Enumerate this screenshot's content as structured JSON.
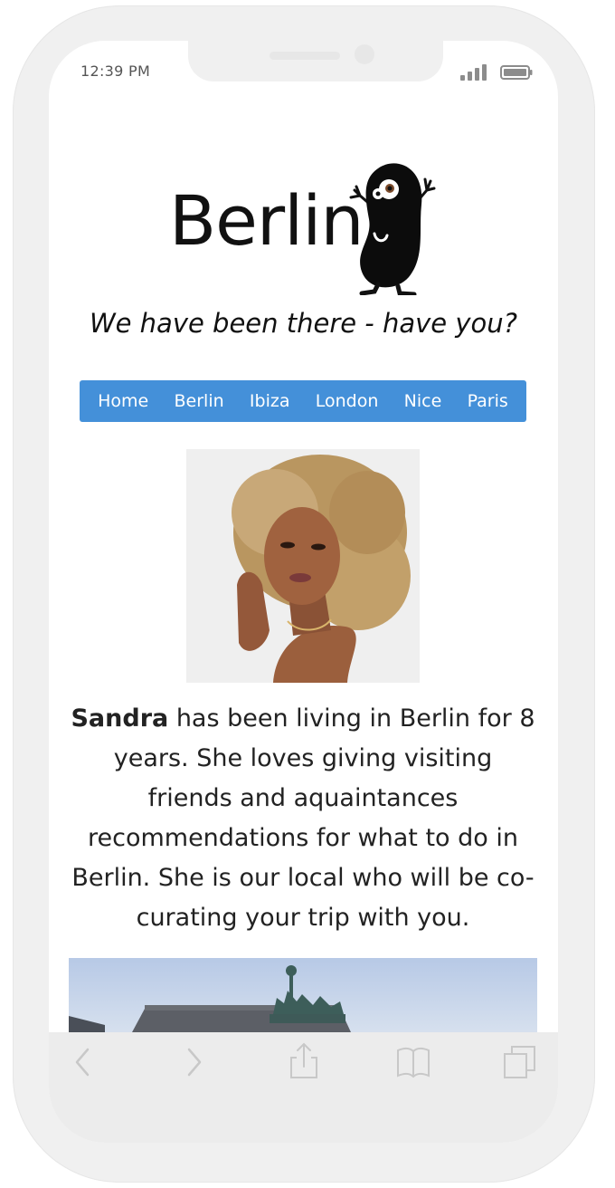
{
  "status_bar": {
    "time": "12:39 PM",
    "icons": [
      "signal-icon",
      "battery-icon"
    ]
  },
  "header": {
    "logo_text": "Berlin",
    "mascot": "bean-mascot-icon",
    "tagline": "We have been there - have you?"
  },
  "nav": {
    "items": [
      {
        "label": "Home"
      },
      {
        "label": "Berlin"
      },
      {
        "label": "Ibiza"
      },
      {
        "label": "London"
      },
      {
        "label": "Nice"
      },
      {
        "label": "Paris"
      }
    ],
    "color": "#4490d9"
  },
  "profile": {
    "name": "Sandra",
    "bio": " has been living in Berlin for 8 years. She loves giving visiting friends and aquaintances recommendations for what to do in Berlin. She is our local who will be co-curating your trip with you."
  },
  "browser_toolbar": {
    "icons": [
      "back-icon",
      "forward-icon",
      "share-icon",
      "bookmarks-icon",
      "tabs-icon"
    ]
  }
}
